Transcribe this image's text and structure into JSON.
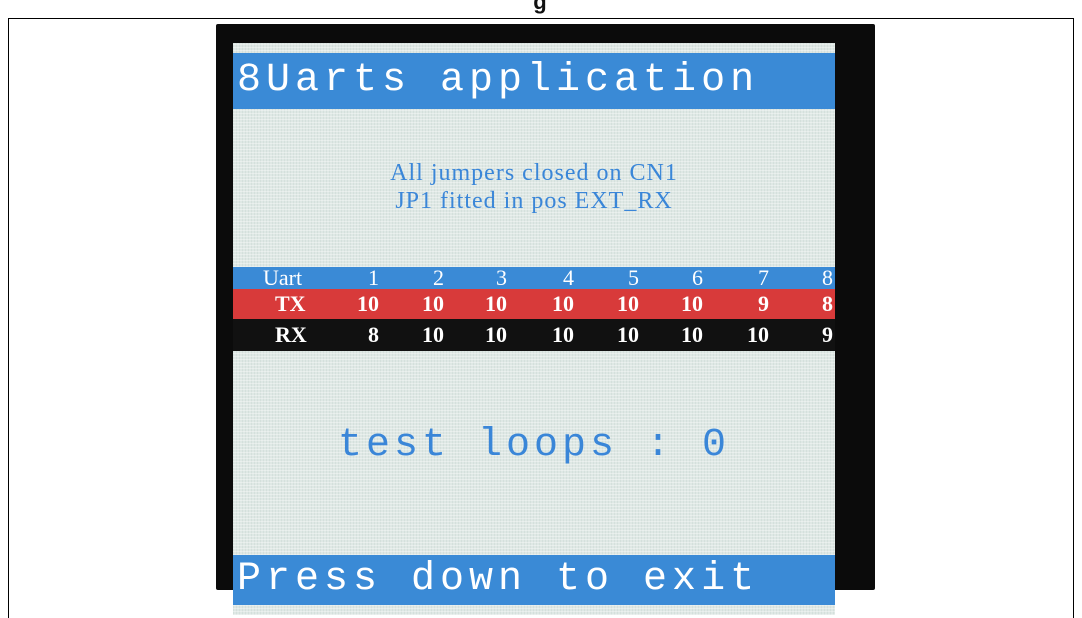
{
  "caption": "g",
  "screen": {
    "title": "8Uarts application",
    "jumper_notes": [
      "All jumpers closed on CN1",
      "JP1 fitted in pos EXT_RX"
    ],
    "uart_table": {
      "header_label": "Uart",
      "columns": [
        "1",
        "2",
        "3",
        "4",
        "5",
        "6",
        "7",
        "8"
      ],
      "tx_label": "TX",
      "tx_values": [
        "10",
        "10",
        "10",
        "10",
        "10",
        "10",
        "9",
        "8"
      ],
      "rx_label": "RX",
      "rx_values": [
        "8",
        "10",
        "10",
        "10",
        "10",
        "10",
        "10",
        "9"
      ]
    },
    "loops_text": "test loops : 0",
    "footer": "Press down to exit"
  },
  "colors": {
    "bar_blue": "#3a8ad6",
    "text_blue": "#3a86d8",
    "tx_red": "#d83a3a",
    "rx_black": "#111111"
  }
}
